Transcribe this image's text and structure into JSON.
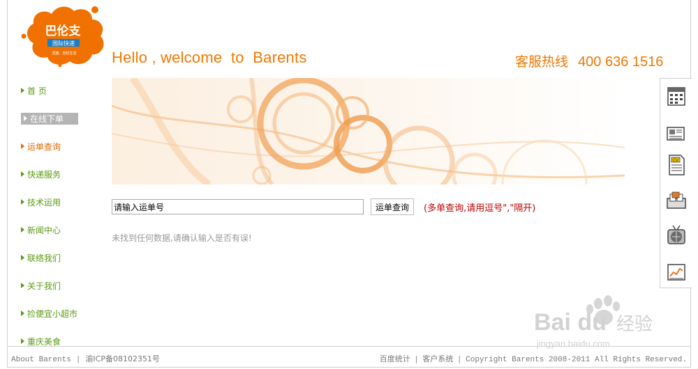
{
  "logo": {
    "brand": "巴伦支",
    "sub": "国际快递",
    "tagline": "迅捷、轻松生活"
  },
  "header": {
    "welcome": "Hello , welcome  to  Barents",
    "hotline_label": "客服热线",
    "hotline_number": "400 636 1516"
  },
  "nav": {
    "items": [
      {
        "label": "首 页"
      },
      {
        "label": "在线下单"
      },
      {
        "label": "运单查询"
      },
      {
        "label": "快递服务"
      },
      {
        "label": "技术运用"
      },
      {
        "label": "新闻中心"
      },
      {
        "label": "联络我们"
      },
      {
        "label": "关于我们"
      },
      {
        "label": "捡便宜小超市"
      },
      {
        "label": "重庆美食"
      }
    ]
  },
  "search": {
    "value": "请输入运单号",
    "button_label": "运单查询",
    "hint": "(多单查询,请用逗号\",\"隔开)"
  },
  "result": {
    "message": "未找到任何数据,请确认输入是否有误!"
  },
  "footer": {
    "about": "About Barents",
    "icp": "渝ICP备08102351号",
    "stats": "百度统计",
    "system": "客户系统",
    "copyright": "Copyright Barents 2008-2011 All Rights Reserved."
  },
  "watermark": {
    "brand": "Bai du",
    "cn": "经验",
    "url": "jingyan.baidu.com"
  },
  "colors": {
    "accent": "#f07800",
    "nav_green": "#5c9b12",
    "hint_red": "#c00000"
  },
  "sidebar_icons": [
    "calendar-icon",
    "newspaper-icon",
    "cv-document-icon",
    "files-icon",
    "globe-tv-icon",
    "chart-icon"
  ]
}
